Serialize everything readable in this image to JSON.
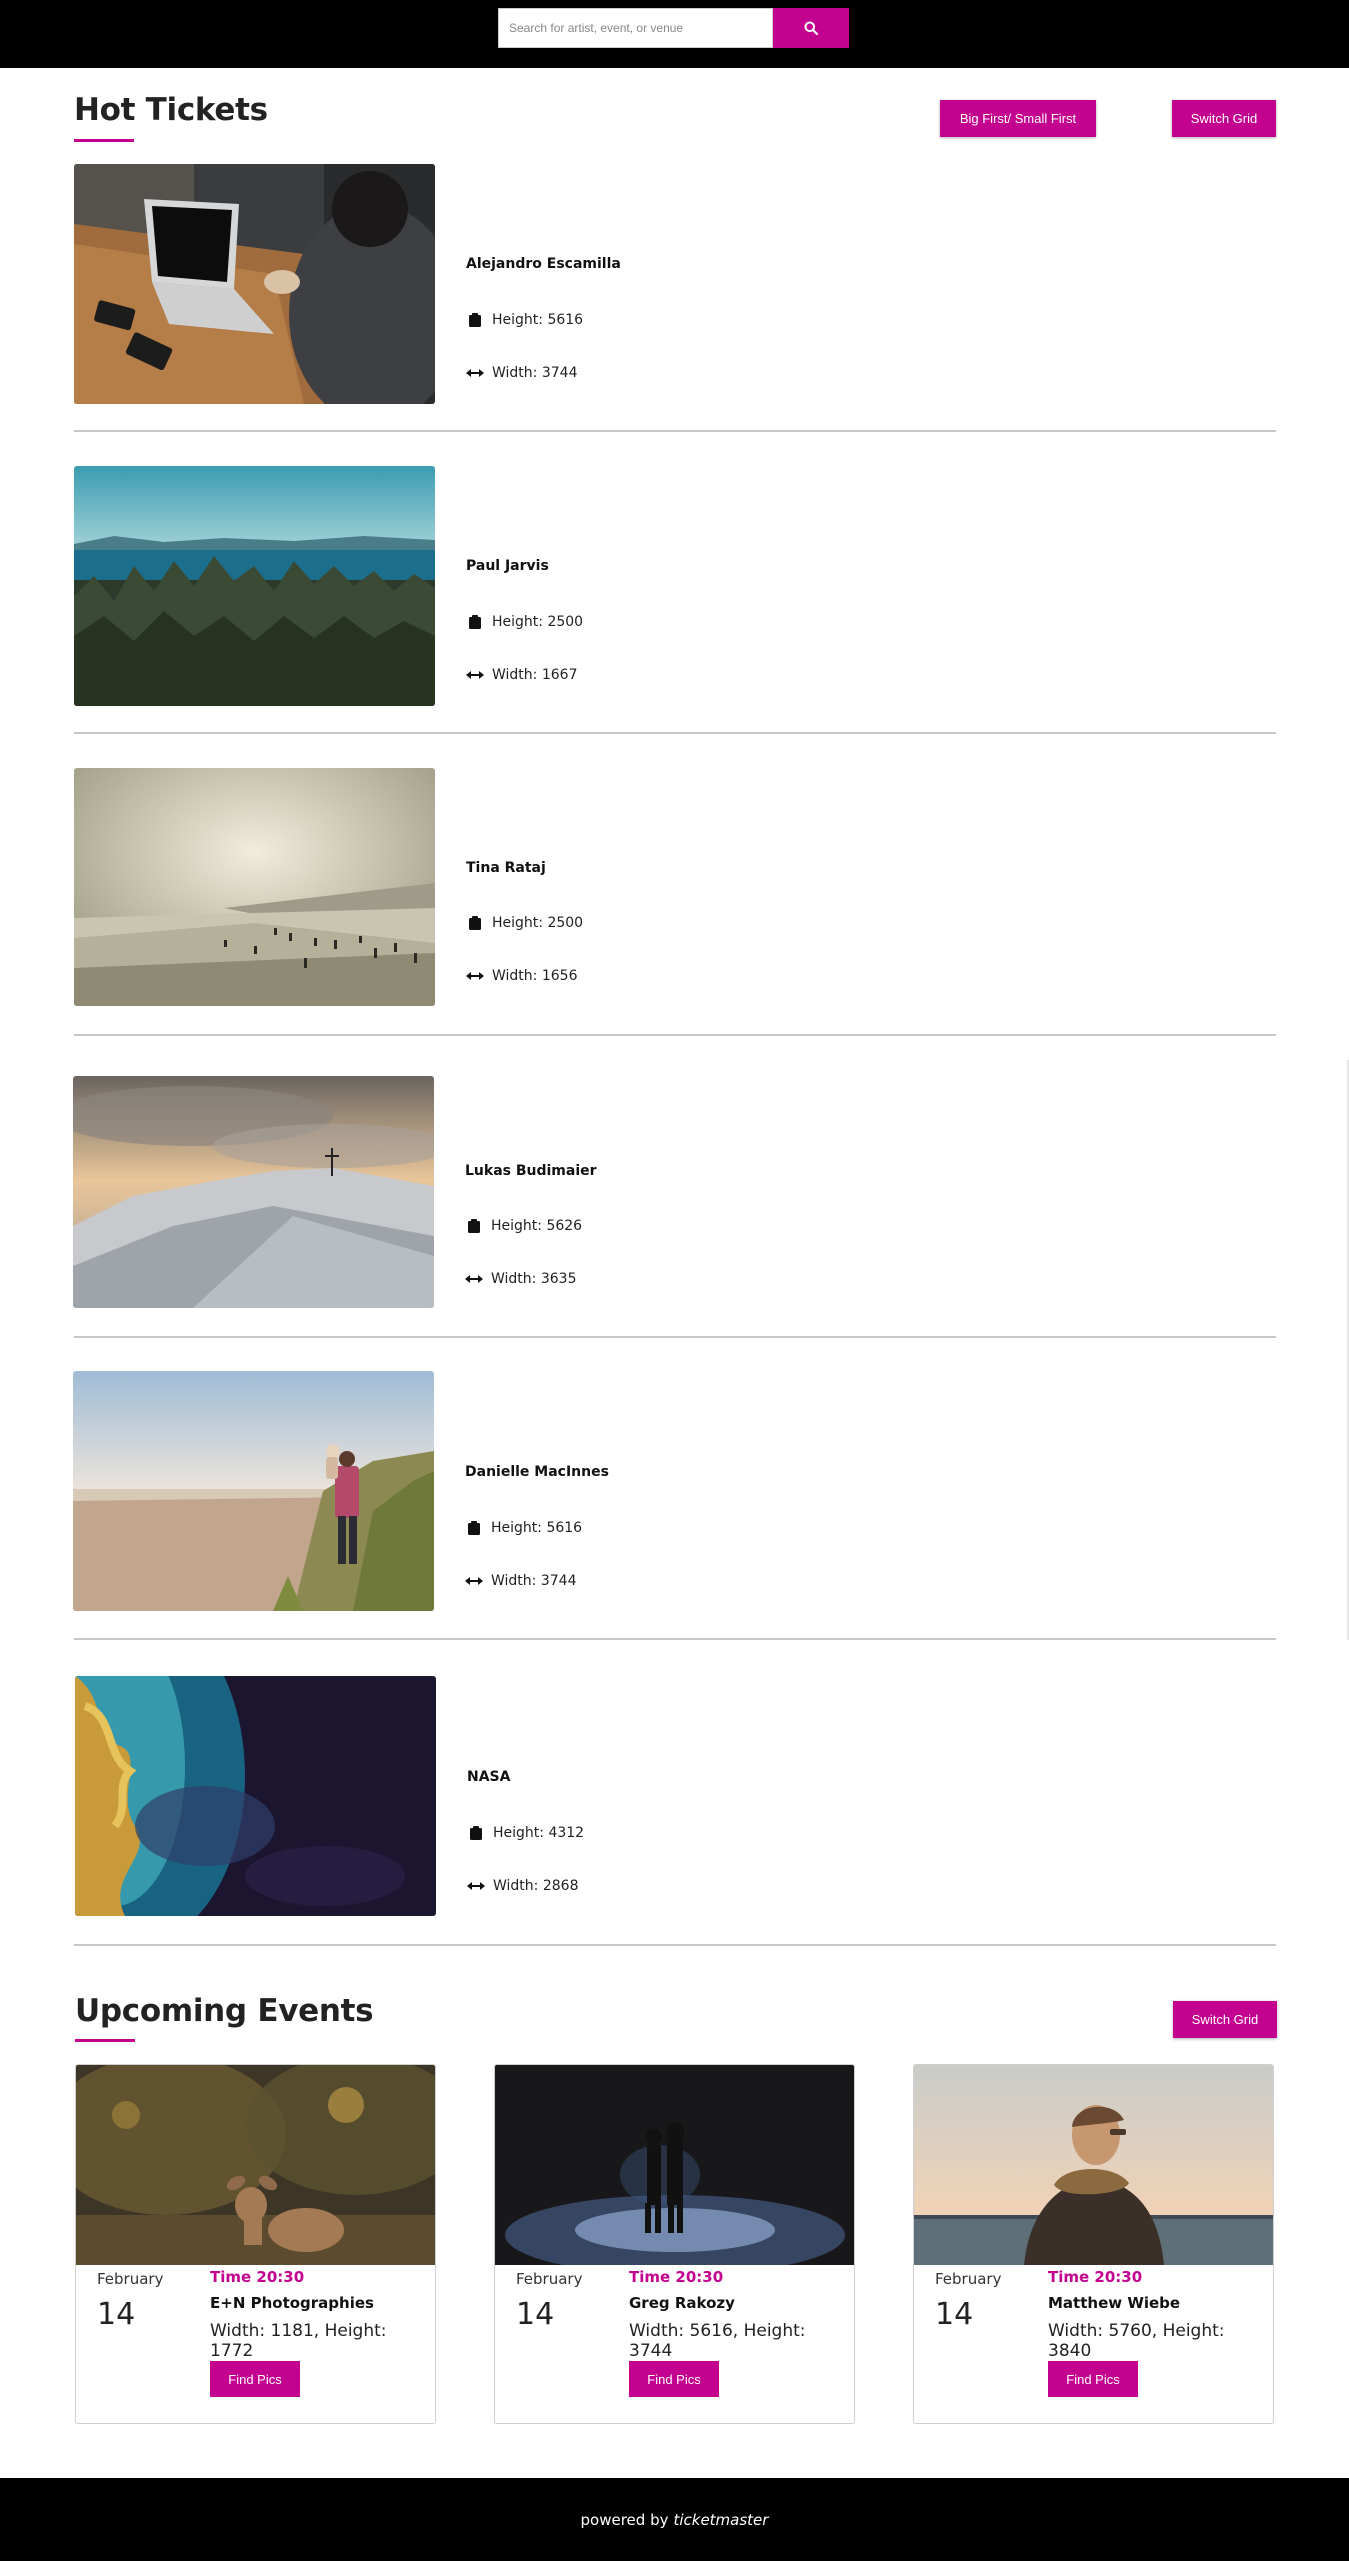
{
  "search": {
    "placeholder": "Search for artist, event, or venue",
    "icon": "search-icon"
  },
  "hot_tickets": {
    "title": "Hot Tickets",
    "sort_button_label": "Big First/ Small First",
    "switch_grid_label": "Switch Grid",
    "height_icon": "clipboard-icon",
    "width_icon": "arrows-horizontal-icon",
    "items": [
      {
        "name": "Alejandro Escamilla",
        "height": "Height: 5616",
        "width": "Width: 3744",
        "image": "laptop-photo"
      },
      {
        "name": "Paul Jarvis",
        "height": "Height: 2500",
        "width": "Width: 1667",
        "image": "forest-lake-photo"
      },
      {
        "name": "Tina Rataj",
        "height": "Height: 2500",
        "width": "Width: 1656",
        "image": "beach-photo"
      },
      {
        "name": "Lukas Budimaier",
        "height": "Height: 5626",
        "width": "Width: 3635",
        "image": "snowy-summit-photo"
      },
      {
        "name": "Danielle MacInnes",
        "height": "Height: 5616",
        "width": "Width: 3744",
        "image": "man-carrying-child-photo"
      },
      {
        "name": "NASA",
        "height": "Height: 4312",
        "width": "Width: 2868",
        "image": "earth-satellite-photo"
      }
    ]
  },
  "upcoming_events": {
    "title": "Upcoming Events",
    "switch_grid_label": "Switch Grid",
    "cards": [
      {
        "month": "February",
        "day": "14",
        "time": "Time 20:30",
        "title": "E+N Photographies",
        "dims": "Width: 1181, Height: 1772",
        "button": "Find Pics",
        "image": "fawn-photo"
      },
      {
        "month": "February",
        "day": "14",
        "time": "Time 20:30",
        "title": "Greg Rakozy",
        "dims": "Width: 5616, Height: 3744",
        "button": "Find Pics",
        "image": "night-silhouette-photo"
      },
      {
        "month": "February",
        "day": "14",
        "time": "Time 20:30",
        "title": "Matthew Wiebe",
        "dims": "Width: 5760, Height: 3840",
        "button": "Find Pics",
        "image": "person-by-water-photo"
      }
    ]
  },
  "footer": {
    "prefix": "powered by",
    "brand": "ticketmaster"
  },
  "colors": {
    "accent": "#c3028f",
    "topbar": "#000000",
    "divider": "#c6c6c6"
  }
}
